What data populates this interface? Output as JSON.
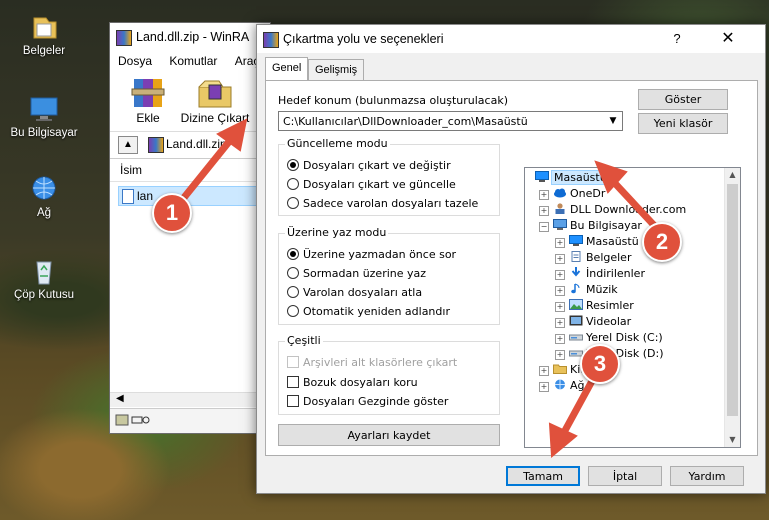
{
  "desktop": {
    "icons": [
      {
        "label": "Belgeler",
        "icon": "folder-icon"
      },
      {
        "label": "Bu Bilgisayar",
        "icon": "computer-icon"
      },
      {
        "label": "Ağ",
        "icon": "network-icon"
      },
      {
        "label": "Çöp Kutusu",
        "icon": "recycle-bin-icon"
      }
    ]
  },
  "winrar": {
    "title": "Land.dll.zip - WinRA",
    "menu": [
      "Dosya",
      "Komutlar",
      "Araçla"
    ],
    "tools": [
      {
        "label": "Ekle",
        "icon": "add-archive-icon"
      },
      {
        "label": "Dizine Çıkart",
        "icon": "extract-to-icon"
      }
    ],
    "path": "Land.dll.zip",
    "column_header": "İsim",
    "row_name": "lan"
  },
  "dialog": {
    "title": "Çıkartma yolu ve seçenekleri",
    "help": "?",
    "close": "✕",
    "tabs": [
      "Genel",
      "Gelişmiş"
    ],
    "destination_label": "Hedef konum (bulunmazsa oluşturulacak)",
    "destination_value": "C:\\Kullanıcılar\\DllDownloader_com\\Masaüstü",
    "show_button": "Göster",
    "new_folder_button": "Yeni klasör",
    "update_mode": {
      "title": "Güncelleme modu",
      "options": [
        {
          "label": "Dosyaları çıkart ve değiştir",
          "checked": true
        },
        {
          "label": "Dosyaları çıkart ve güncelle",
          "checked": false
        },
        {
          "label": "Sadece varolan dosyaları tazele",
          "checked": false
        }
      ]
    },
    "overwrite_mode": {
      "title": "Üzerine yaz modu",
      "options": [
        {
          "label": "Üzerine yazmadan önce sor",
          "checked": true
        },
        {
          "label": "Sormadan üzerine yaz",
          "checked": false
        },
        {
          "label": "Varolan dosyaları atla",
          "checked": false
        },
        {
          "label": "Otomatik yeniden adlandır",
          "checked": false
        }
      ]
    },
    "misc": {
      "title": "Çeşitli",
      "options": [
        {
          "label": "Arşivleri alt klasörlere çıkart",
          "checked": false,
          "disabled": true
        },
        {
          "label": "Bozuk dosyaları koru",
          "checked": false,
          "disabled": false
        },
        {
          "label": "Dosyaları Gezginde göster",
          "checked": false,
          "disabled": false
        }
      ]
    },
    "save_settings_button": "Ayarları kaydet",
    "tree": [
      {
        "label": "Masaüstü",
        "icon": "desktop-icon",
        "level": 0,
        "expander": "",
        "selected": true
      },
      {
        "label": "OneDr",
        "icon": "cloud-icon",
        "level": 1,
        "expander": "+",
        "selected": false
      },
      {
        "label": "DLL Downloader.com",
        "icon": "user-icon",
        "level": 1,
        "expander": "+",
        "selected": false
      },
      {
        "label": "Bu Bilgisayar",
        "icon": "computer-icon",
        "level": 1,
        "expander": "−",
        "selected": false
      },
      {
        "label": "Masaüstü",
        "icon": "desktop-icon",
        "level": 2,
        "expander": "+",
        "selected": false
      },
      {
        "label": "Belgeler",
        "icon": "documents-icon",
        "level": 2,
        "expander": "+",
        "selected": false
      },
      {
        "label": "İndirilenler",
        "icon": "download-icon",
        "level": 2,
        "expander": "+",
        "selected": false
      },
      {
        "label": "Müzik",
        "icon": "music-icon",
        "level": 2,
        "expander": "+",
        "selected": false
      },
      {
        "label": "Resimler",
        "icon": "pictures-icon",
        "level": 2,
        "expander": "+",
        "selected": false
      },
      {
        "label": "Videolar",
        "icon": "videos-icon",
        "level": 2,
        "expander": "+",
        "selected": false
      },
      {
        "label": "Yerel Disk (C:)",
        "icon": "drive-icon",
        "level": 2,
        "expander": "+",
        "selected": false
      },
      {
        "label": "Yerel Disk (D:)",
        "icon": "drive-icon",
        "level": 2,
        "expander": "+",
        "selected": false
      },
      {
        "label": "Kitapl",
        "icon": "library-icon",
        "level": 1,
        "expander": "+",
        "selected": false
      },
      {
        "label": "Ağ",
        "icon": "network-icon",
        "level": 1,
        "expander": "+",
        "selected": false
      }
    ],
    "ok_button": "Tamam",
    "cancel_button": "İptal",
    "help_button": "Yardım"
  },
  "annotations": {
    "steps": [
      "1",
      "2",
      "3"
    ],
    "color": "#e0513c"
  }
}
